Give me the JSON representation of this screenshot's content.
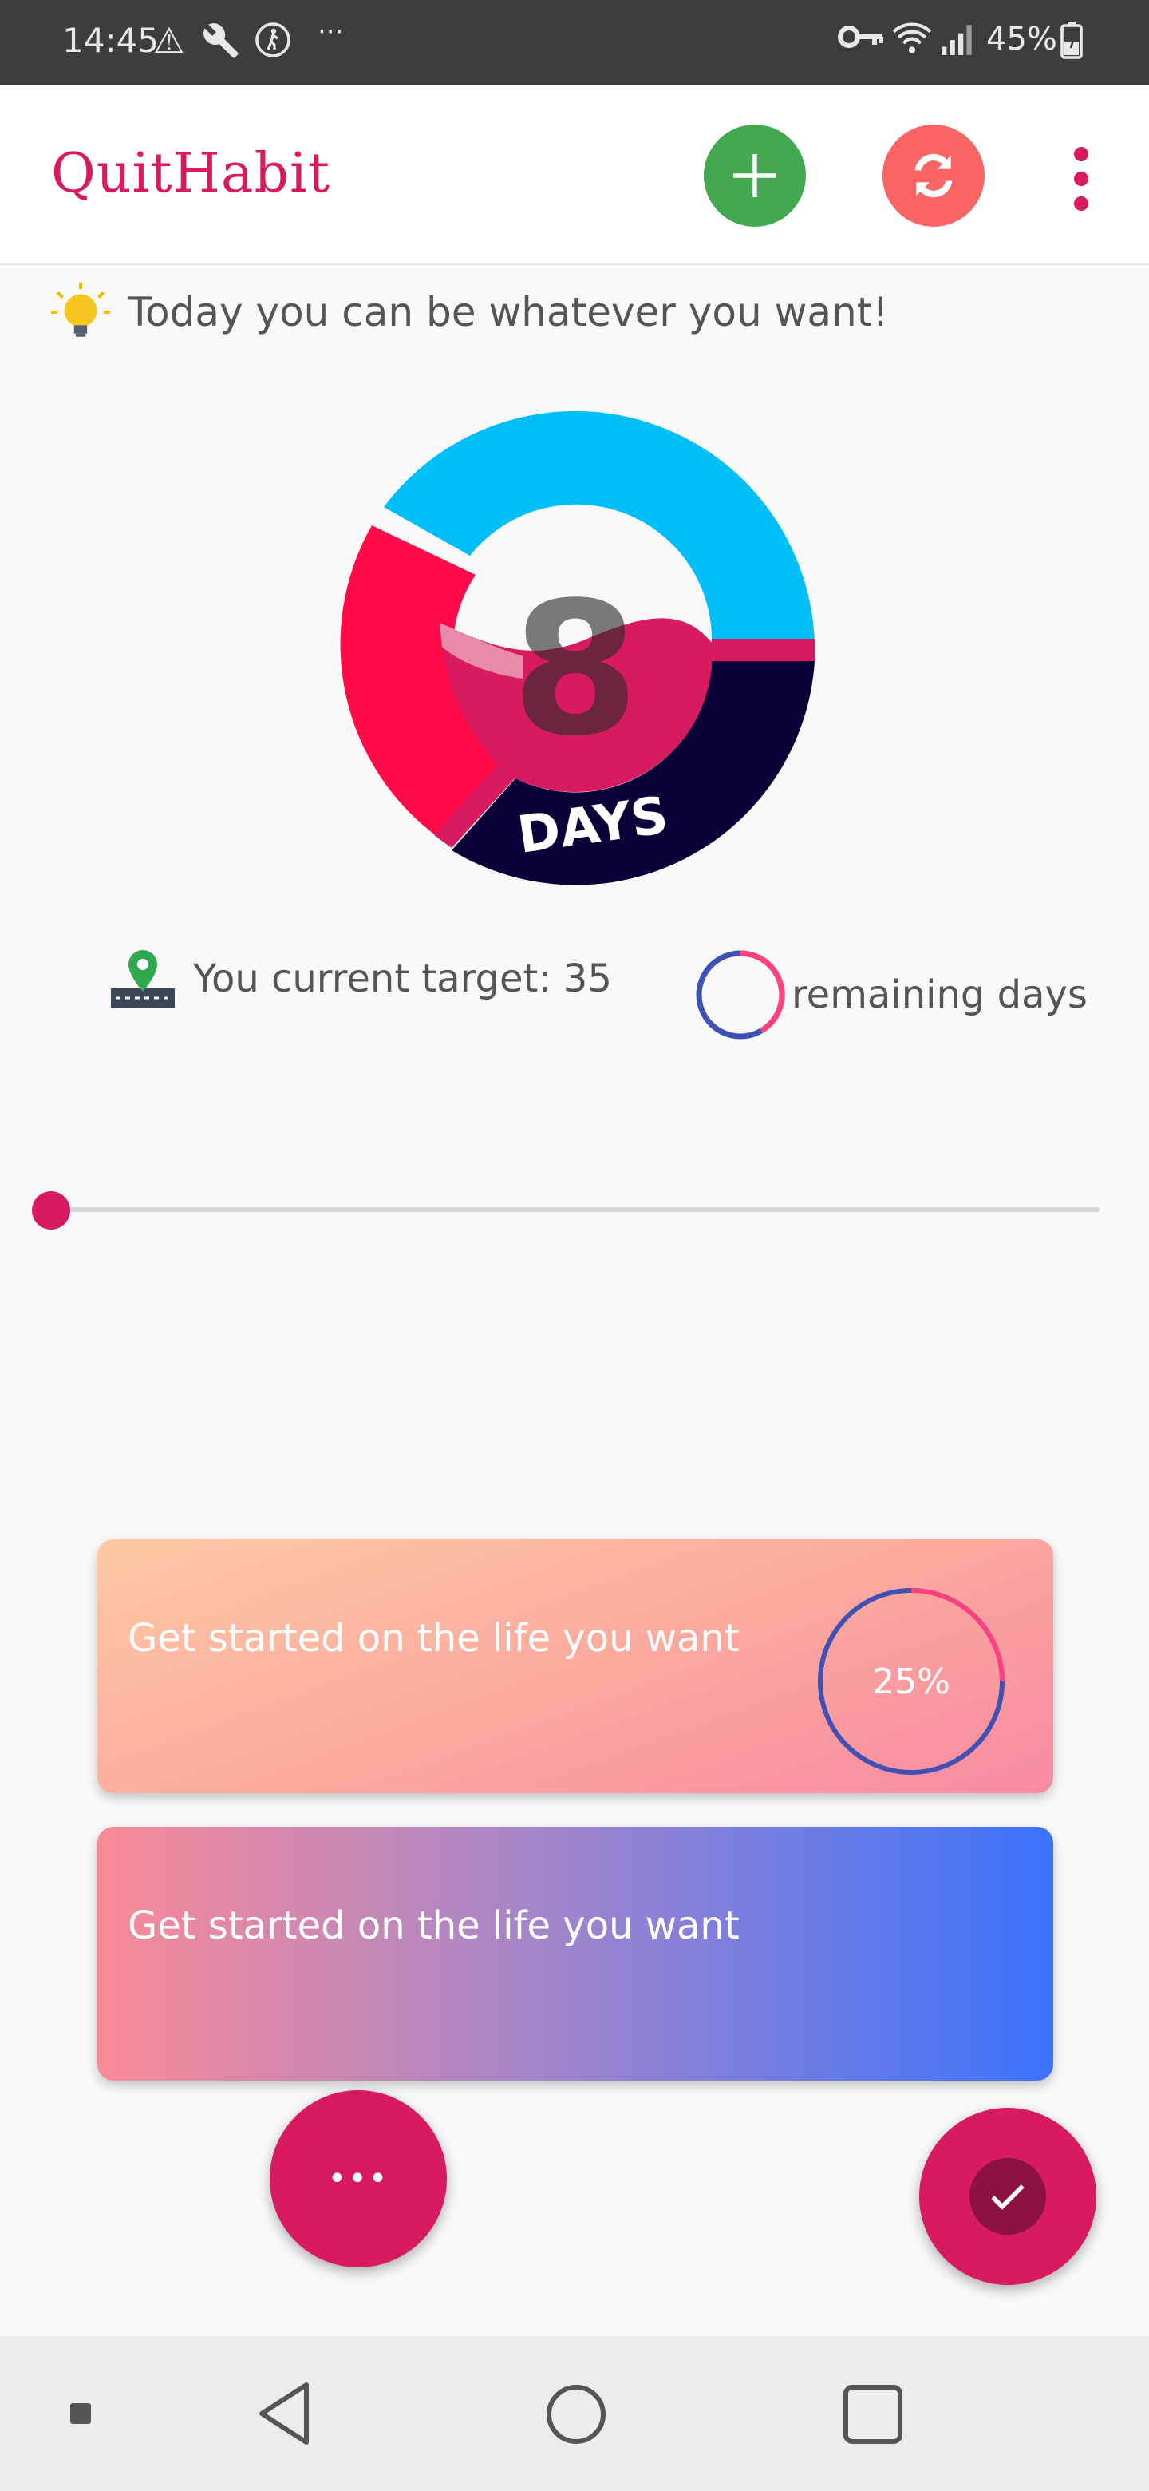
{
  "status_bar": {
    "time": "14:45",
    "battery": "45%",
    "icons": [
      "warning-icon",
      "wrench-icon",
      "accessibility-icon",
      "more-notifications-icon",
      "key-icon",
      "wifi-icon",
      "signal-icon",
      "battery-charging-icon"
    ]
  },
  "app_bar": {
    "title": "QuitHabit",
    "colors": {
      "accent": "#d81b60",
      "add": "#43a850",
      "sync": "#f96565"
    }
  },
  "tip": {
    "text": "Today you can be whatever you want!"
  },
  "counter": {
    "value": "8",
    "unit": "DAYS"
  },
  "target": {
    "text": "You current target: 35",
    "remaining_label": "remaining days"
  },
  "slider": {
    "value_fraction": 0.0
  },
  "cards": [
    {
      "text": "Get started on the life you want",
      "progress_label": "25%",
      "progress": 0.25
    },
    {
      "text": "Get started on the life you want"
    }
  ],
  "fab": {
    "more_label": "•••"
  }
}
